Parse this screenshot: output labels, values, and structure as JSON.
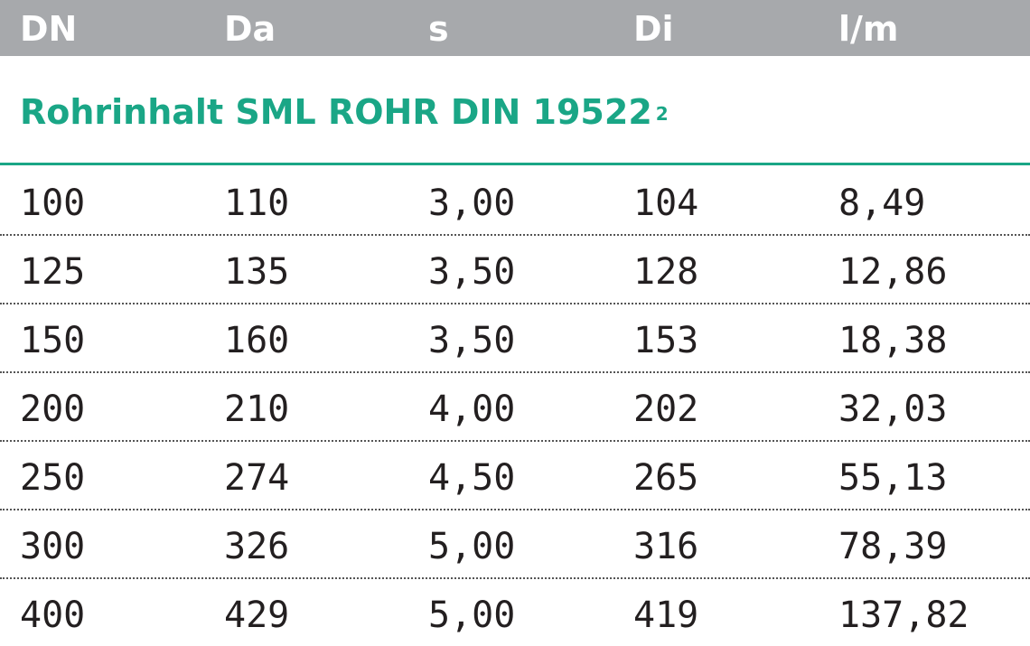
{
  "table": {
    "headers": [
      "DN",
      "Da",
      "s",
      "Di",
      "l/m"
    ],
    "section_title": "Rohrinhalt SML ROHR DIN 19522",
    "section_title_sup": "2",
    "rows": [
      [
        "100",
        "110",
        "3,00",
        "104",
        "8,49"
      ],
      [
        "125",
        "135",
        "3,50",
        "128",
        "12,86"
      ],
      [
        "150",
        "160",
        "3,50",
        "153",
        "18,38"
      ],
      [
        "200",
        "210",
        "4,00",
        "202",
        "32,03"
      ],
      [
        "250",
        "274",
        "4,50",
        "265",
        "55,13"
      ],
      [
        "300",
        "326",
        "5,00",
        "316",
        "78,39"
      ],
      [
        "400",
        "429",
        "5,00",
        "419",
        "137,82"
      ]
    ]
  },
  "colors": {
    "header_bg": "#a7a9ac",
    "header_text": "#ffffff",
    "accent": "#1aa686",
    "body_text": "#231f20"
  }
}
